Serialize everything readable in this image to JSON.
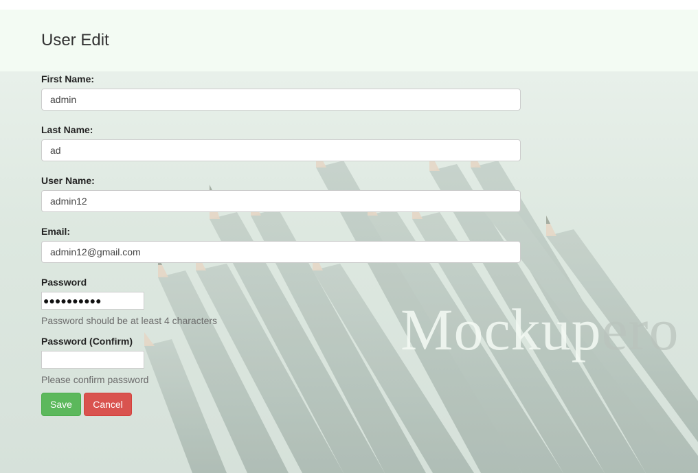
{
  "page": {
    "title": "User Edit",
    "watermark": {
      "main": "Mockup",
      "faded": "ero"
    }
  },
  "form": {
    "first_name": {
      "label": "First Name:",
      "value": "admin"
    },
    "last_name": {
      "label": "Last Name:",
      "value": "ad"
    },
    "user_name": {
      "label": "User Name:",
      "value": "admin12"
    },
    "email": {
      "label": "Email:",
      "value": "admin12@gmail.com"
    },
    "password": {
      "label": "Password",
      "masked_value": "●●●●●●●●●●",
      "help": "Password should be at least 4 characters"
    },
    "password_confirm": {
      "label": "Password (Confirm)",
      "value": "",
      "help": "Please confirm password"
    }
  },
  "buttons": {
    "save_label": "Save",
    "cancel_label": "Cancel"
  },
  "colors": {
    "header_bg": "#f3fbf3",
    "save": "#5cb85c",
    "cancel": "#d9534f"
  }
}
